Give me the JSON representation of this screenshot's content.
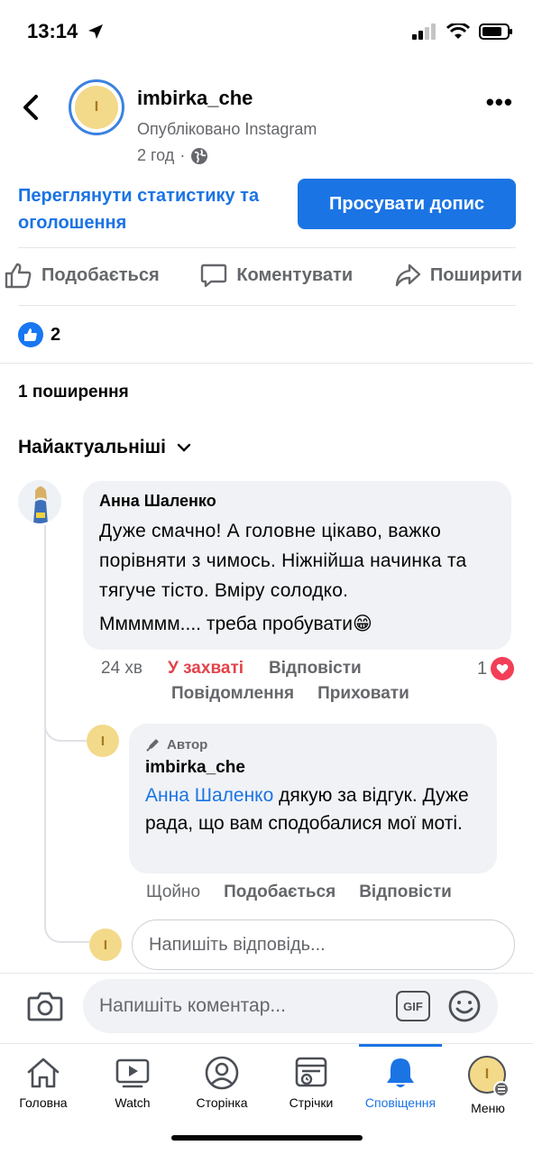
{
  "status": {
    "time": "13:14"
  },
  "header": {
    "avatar_letter": "I",
    "name": "imbirka_che",
    "subtitle": "Опубліковано Instagram",
    "time": "2 год",
    "dot": "·"
  },
  "post": {
    "stats_link": "Переглянути статистику та оголошення",
    "promote_label": "Просувати допис",
    "actions": {
      "like": "Подобається",
      "comment": "Коментувати",
      "share": "Поширити"
    },
    "like_count": "2",
    "shares": "1 поширення",
    "sort_label": "Найактуальніші"
  },
  "comment": {
    "author": "Анна Шаленко",
    "text": "Дуже смачно! А головне цікаво, важко порівняти з чимось. Ніжнійша начинка та  тягуче тісто. Вміру солодко.",
    "text2": "Мммммм.... треба пробувати",
    "emoji": "😁",
    "time": "24 хв",
    "reaction": "У захваті",
    "reply": "Відповісти",
    "message": "Повідомлення",
    "hide": "Приховати",
    "react_count": "1"
  },
  "reply": {
    "avatar_letter": "I",
    "author_tag": "Автор",
    "author": "imbirka_che",
    "mention": "Анна Шаленко",
    "text": " дякую за відгук. Дуже рада, що вам сподобалися мої моті.",
    "time": "Щойно",
    "like": "Подобається",
    "reply": "Відповісти"
  },
  "reply_input": {
    "placeholder": "Напишіть відповідь..."
  },
  "composer": {
    "placeholder": "Напишіть коментар...",
    "gif_label": "GIF"
  },
  "tabs": [
    {
      "label": "Головна",
      "icon": "home-icon"
    },
    {
      "label": "Watch",
      "icon": "watch-icon"
    },
    {
      "label": "Сторінка",
      "icon": "page-icon"
    },
    {
      "label": "Стрічки",
      "icon": "feeds-icon"
    },
    {
      "label": "Сповіщення",
      "icon": "bell-icon"
    },
    {
      "label": "Меню",
      "icon": "menu-avatar"
    }
  ],
  "colors": {
    "accent": "#1b74e4",
    "love": "#e2434a"
  }
}
